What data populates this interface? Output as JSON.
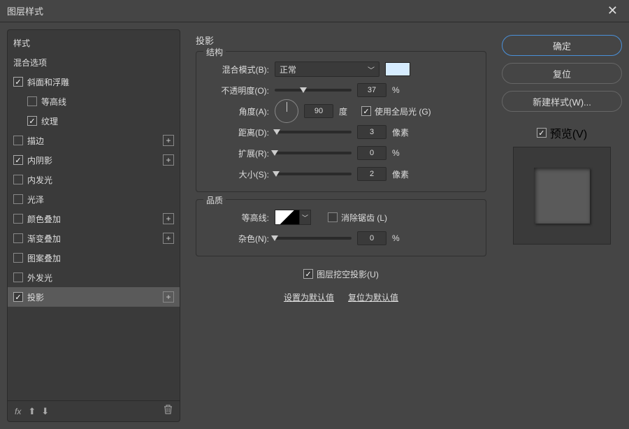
{
  "title": "图层样式",
  "left": {
    "header1": "样式",
    "header2": "混合选项",
    "items": [
      {
        "label": "斜面和浮雕",
        "checked": true,
        "plus": false,
        "indent": false
      },
      {
        "label": "等高线",
        "checked": false,
        "plus": false,
        "indent": true
      },
      {
        "label": "纹理",
        "checked": true,
        "plus": false,
        "indent": true
      },
      {
        "label": "描边",
        "checked": false,
        "plus": true,
        "indent": false
      },
      {
        "label": "内阴影",
        "checked": true,
        "plus": true,
        "indent": false
      },
      {
        "label": "内发光",
        "checked": false,
        "plus": false,
        "indent": false
      },
      {
        "label": "光泽",
        "checked": false,
        "plus": false,
        "indent": false
      },
      {
        "label": "颜色叠加",
        "checked": false,
        "plus": true,
        "indent": false
      },
      {
        "label": "渐变叠加",
        "checked": false,
        "plus": true,
        "indent": false
      },
      {
        "label": "图案叠加",
        "checked": false,
        "plus": false,
        "indent": false
      },
      {
        "label": "外发光",
        "checked": false,
        "plus": false,
        "indent": false
      },
      {
        "label": "投影",
        "checked": true,
        "plus": true,
        "indent": false,
        "selected": true
      }
    ],
    "fx": "fx"
  },
  "middle": {
    "title": "投影",
    "structure": {
      "legend": "结构",
      "blend_label": "混合模式(B):",
      "blend_value": "正常",
      "color": "#d6ecff",
      "opacity_label": "不透明度(O):",
      "opacity_value": "37",
      "opacity_unit": "%",
      "angle_label": "角度(A):",
      "angle_value": "90",
      "angle_unit": "度",
      "global_light": "使用全局光 (G)",
      "global_light_checked": true,
      "distance_label": "距离(D):",
      "distance_value": "3",
      "distance_unit": "像素",
      "spread_label": "扩展(R):",
      "spread_value": "0",
      "spread_unit": "%",
      "size_label": "大小(S):",
      "size_value": "2",
      "size_unit": "像素"
    },
    "quality": {
      "legend": "品质",
      "contour_label": "等高线:",
      "antialias": "消除锯齿 (L)",
      "antialias_checked": false,
      "noise_label": "杂色(N):",
      "noise_value": "0",
      "noise_unit": "%"
    },
    "knockout": "图层挖空投影(U)",
    "knockout_checked": true,
    "default_set": "设置为默认值",
    "default_reset": "复位为默认值"
  },
  "right": {
    "ok": "确定",
    "cancel": "复位",
    "new_style": "新建样式(W)...",
    "preview": "预览(V)",
    "preview_checked": true
  }
}
